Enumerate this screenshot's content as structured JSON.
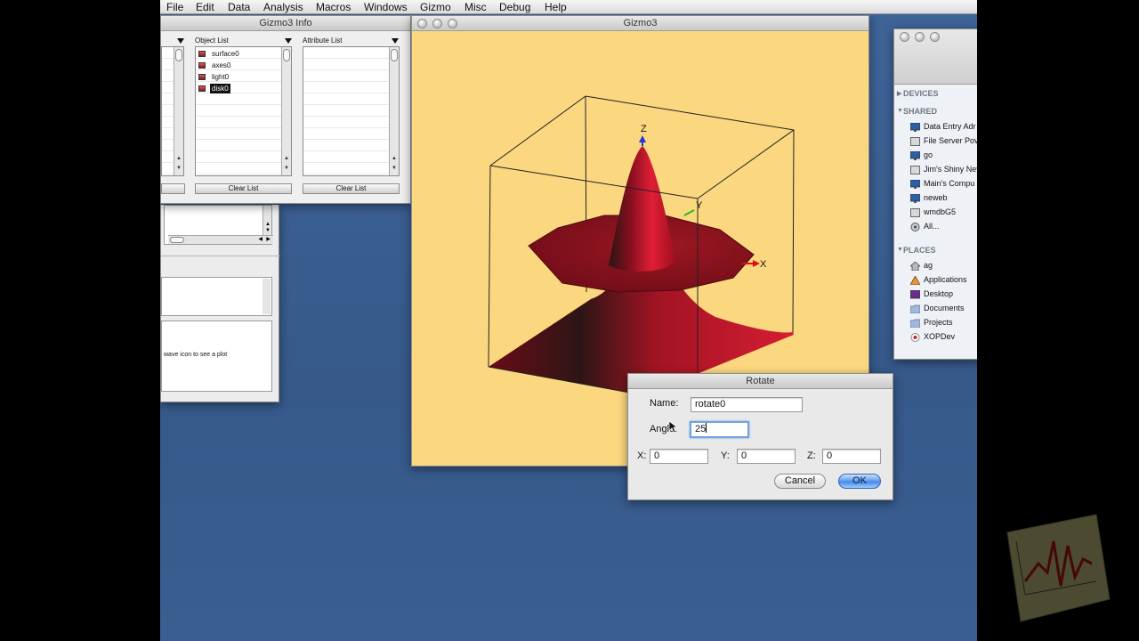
{
  "menu_bar": [
    "File",
    "Edit",
    "Data",
    "Analysis",
    "Macros",
    "Windows",
    "Gizmo",
    "Misc",
    "Debug",
    "Help"
  ],
  "info_window": {
    "title": "Gizmo3 Info",
    "object_list_header": "Object List",
    "attribute_list_header": "Attribute List",
    "objects": [
      "surface0",
      "axes0",
      "light0",
      "disk0"
    ],
    "selected_object": "disk0",
    "clear_list_label": "Clear List",
    "clear_list_label_2": "Clear List"
  },
  "lower_panel": {
    "hint_text": "wave icon to see a plot"
  },
  "gizmo_window": {
    "title": "Gizmo3",
    "axis_x": "X",
    "axis_y": "Y",
    "axis_z": "Z"
  },
  "finder_sidebar": {
    "sections": [
      {
        "heading": "DEVICES",
        "items": []
      },
      {
        "heading": "SHARED",
        "items": [
          {
            "label": "Data Entry Adr",
            "icon": "display-icon"
          },
          {
            "label": "File Server Pov",
            "icon": "server-icon"
          },
          {
            "label": "go",
            "icon": "display-icon"
          },
          {
            "label": "Jim's Shiny Nev",
            "icon": "server-icon"
          },
          {
            "label": "Main's Compu",
            "icon": "display-icon"
          },
          {
            "label": "neweb",
            "icon": "display-icon"
          },
          {
            "label": "wmdbG5",
            "icon": "server-icon"
          },
          {
            "label": "All...",
            "icon": "network-icon"
          }
        ]
      },
      {
        "heading": "PLACES",
        "items": [
          {
            "label": "ag",
            "icon": "home-icon"
          },
          {
            "label": "Applications",
            "icon": "applications-icon"
          },
          {
            "label": "Desktop",
            "icon": "desktop-icon"
          },
          {
            "label": "Documents",
            "icon": "folder-icon"
          },
          {
            "label": "Projects",
            "icon": "folder-icon"
          },
          {
            "label": "XOPDev",
            "icon": "xop-icon"
          }
        ]
      }
    ]
  },
  "rotate_dialog": {
    "title": "Rotate",
    "name_label": "Name:",
    "name_value": "rotate0",
    "angle_label": "Angle:",
    "angle_value": "25",
    "x_label": "X:",
    "x_value": "0",
    "y_label": "Y:",
    "y_value": "0",
    "z_label": "Z:",
    "z_value": "0",
    "cancel_label": "Cancel",
    "ok_label": "OK"
  },
  "colors": {
    "desktop": "#3a5f93",
    "plot_background": "#fbd77f",
    "surface_red": "#c8102e",
    "focus_ring": "#6fa2e0"
  }
}
